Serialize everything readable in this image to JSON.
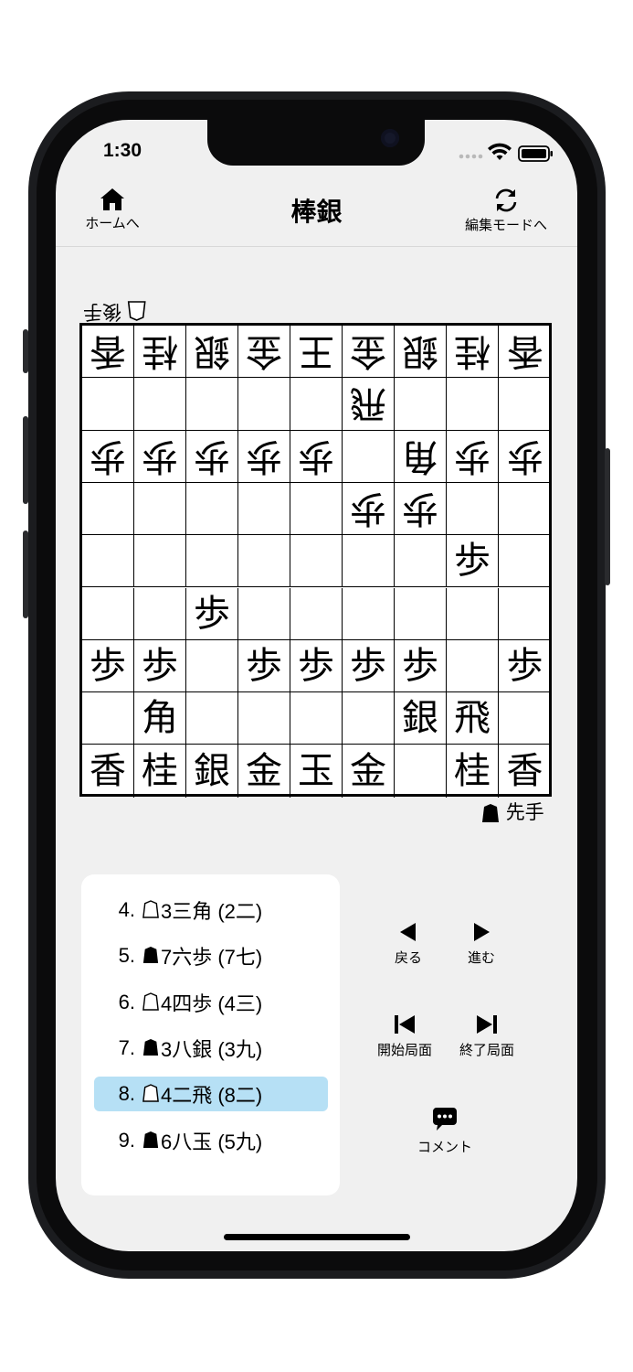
{
  "status_bar": {
    "time": "1:30"
  },
  "header": {
    "title": "棒銀",
    "home_label": "ホームへ",
    "edit_label": "編集モードへ"
  },
  "players": {
    "gote": "後手",
    "sente": "先手"
  },
  "board": {
    "rows": [
      [
        {
          "p": "香",
          "o": "g"
        },
        {
          "p": "桂",
          "o": "g"
        },
        {
          "p": "銀",
          "o": "g"
        },
        {
          "p": "金",
          "o": "g"
        },
        {
          "p": "王",
          "o": "g"
        },
        {
          "p": "金",
          "o": "g"
        },
        {
          "p": "銀",
          "o": "g"
        },
        {
          "p": "桂",
          "o": "g"
        },
        {
          "p": "香",
          "o": "g"
        }
      ],
      [
        {
          "p": "",
          "o": ""
        },
        {
          "p": "",
          "o": ""
        },
        {
          "p": "",
          "o": ""
        },
        {
          "p": "",
          "o": ""
        },
        {
          "p": "",
          "o": ""
        },
        {
          "p": "飛",
          "o": "g"
        },
        {
          "p": "",
          "o": ""
        },
        {
          "p": "",
          "o": ""
        },
        {
          "p": "",
          "o": ""
        }
      ],
      [
        {
          "p": "歩",
          "o": "g"
        },
        {
          "p": "歩",
          "o": "g"
        },
        {
          "p": "歩",
          "o": "g"
        },
        {
          "p": "歩",
          "o": "g"
        },
        {
          "p": "歩",
          "o": "g"
        },
        {
          "p": "",
          "o": ""
        },
        {
          "p": "角",
          "o": "g"
        },
        {
          "p": "歩",
          "o": "g"
        },
        {
          "p": "歩",
          "o": "g"
        }
      ],
      [
        {
          "p": "",
          "o": ""
        },
        {
          "p": "",
          "o": ""
        },
        {
          "p": "",
          "o": ""
        },
        {
          "p": "",
          "o": ""
        },
        {
          "p": "",
          "o": ""
        },
        {
          "p": "歩",
          "o": "g"
        },
        {
          "p": "歩",
          "o": "g"
        },
        {
          "p": "",
          "o": ""
        },
        {
          "p": "",
          "o": ""
        }
      ],
      [
        {
          "p": "",
          "o": ""
        },
        {
          "p": "",
          "o": ""
        },
        {
          "p": "",
          "o": ""
        },
        {
          "p": "",
          "o": ""
        },
        {
          "p": "",
          "o": ""
        },
        {
          "p": "",
          "o": ""
        },
        {
          "p": "",
          "o": ""
        },
        {
          "p": "歩",
          "o": "s"
        },
        {
          "p": "",
          "o": ""
        }
      ],
      [
        {
          "p": "",
          "o": ""
        },
        {
          "p": "",
          "o": ""
        },
        {
          "p": "歩",
          "o": "s"
        },
        {
          "p": "",
          "o": ""
        },
        {
          "p": "",
          "o": ""
        },
        {
          "p": "",
          "o": ""
        },
        {
          "p": "",
          "o": ""
        },
        {
          "p": "",
          "o": ""
        },
        {
          "p": "",
          "o": ""
        }
      ],
      [
        {
          "p": "歩",
          "o": "s"
        },
        {
          "p": "歩",
          "o": "s"
        },
        {
          "p": "",
          "o": ""
        },
        {
          "p": "歩",
          "o": "s"
        },
        {
          "p": "歩",
          "o": "s"
        },
        {
          "p": "歩",
          "o": "s"
        },
        {
          "p": "歩",
          "o": "s"
        },
        {
          "p": "",
          "o": ""
        },
        {
          "p": "歩",
          "o": "s"
        }
      ],
      [
        {
          "p": "",
          "o": ""
        },
        {
          "p": "角",
          "o": "s"
        },
        {
          "p": "",
          "o": ""
        },
        {
          "p": "",
          "o": ""
        },
        {
          "p": "",
          "o": ""
        },
        {
          "p": "",
          "o": ""
        },
        {
          "p": "銀",
          "o": "s"
        },
        {
          "p": "飛",
          "o": "s"
        },
        {
          "p": "",
          "o": ""
        }
      ],
      [
        {
          "p": "香",
          "o": "s"
        },
        {
          "p": "桂",
          "o": "s"
        },
        {
          "p": "銀",
          "o": "s"
        },
        {
          "p": "金",
          "o": "s"
        },
        {
          "p": "玉",
          "o": "s"
        },
        {
          "p": "金",
          "o": "s"
        },
        {
          "p": "",
          "o": ""
        },
        {
          "p": "桂",
          "o": "s"
        },
        {
          "p": "香",
          "o": "s"
        }
      ]
    ]
  },
  "moves": [
    {
      "num": "4.",
      "side": "gote",
      "text": "3三角 (2二)",
      "selected": false
    },
    {
      "num": "5.",
      "side": "sente",
      "text": "7六歩 (7七)",
      "selected": false
    },
    {
      "num": "6.",
      "side": "gote",
      "text": "4四歩 (4三)",
      "selected": false
    },
    {
      "num": "7.",
      "side": "sente",
      "text": "3八銀 (3九)",
      "selected": false
    },
    {
      "num": "8.",
      "side": "gote",
      "text": "4二飛 (8二)",
      "selected": true
    },
    {
      "num": "9.",
      "side": "sente",
      "text": "6八玉 (5九)",
      "selected": false
    }
  ],
  "controls": {
    "back": "戻る",
    "forward": "進む",
    "first": "開始局面",
    "last": "終了局面",
    "comment": "コメント"
  },
  "icons": {
    "home": "home-icon",
    "refresh": "refresh-icon",
    "back": "triangle-left-icon",
    "forward": "triangle-right-icon",
    "first": "skip-first-icon",
    "last": "skip-last-icon",
    "comment": "comment-bubble-icon",
    "sente_piece": "sente-piece-icon",
    "gote_piece": "gote-piece-icon"
  }
}
